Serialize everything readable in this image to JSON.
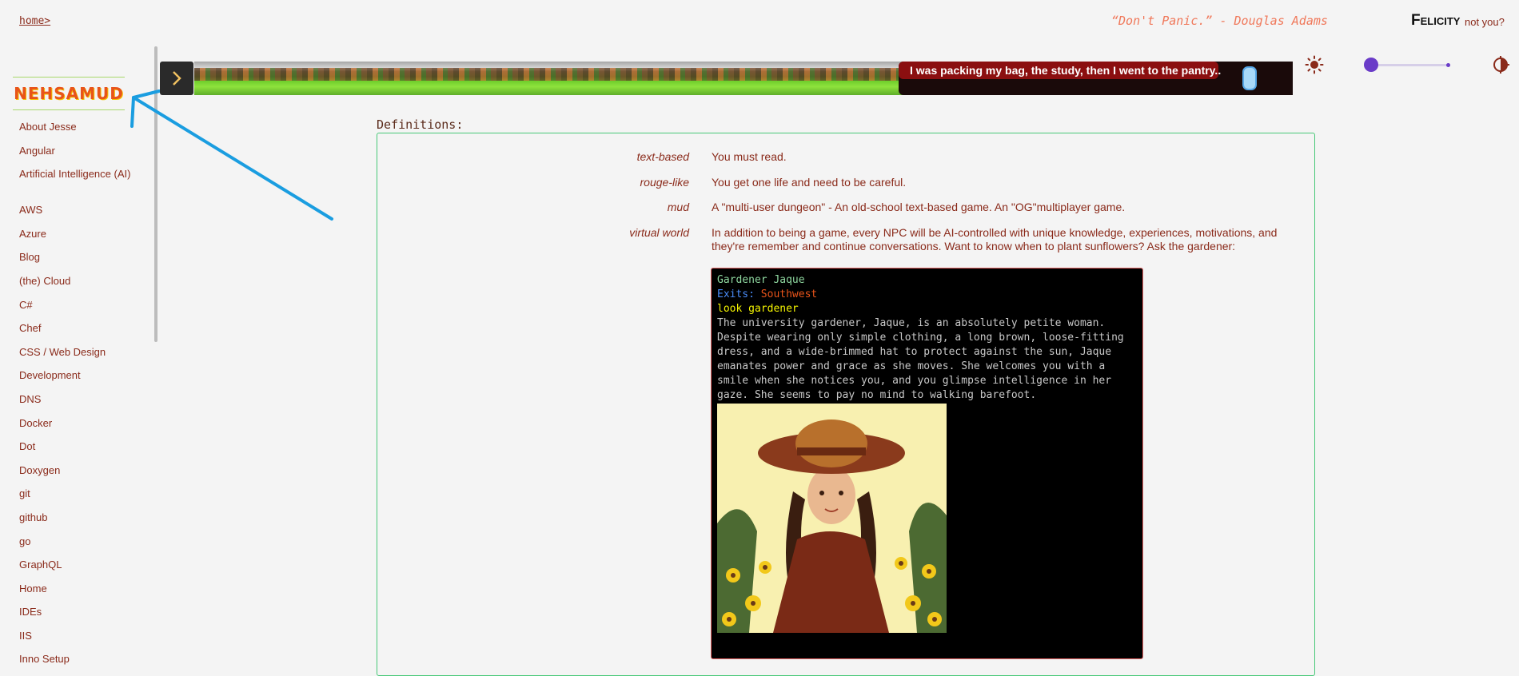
{
  "header": {
    "breadcrumb": "home>",
    "quote": "“Don't Panic.” - Douglas Adams",
    "user_name": "Felicity",
    "not_you": "not you?"
  },
  "sidebar": {
    "logo": "NEHSAMUD",
    "items": [
      "About Jesse",
      "Angular",
      "Artificial Intelligence (AI)",
      "AWS",
      "Azure",
      "Blog",
      "(the) Cloud",
      "C#",
      "Chef",
      "CSS / Web Design",
      "Development",
      "DNS",
      "Docker",
      "Dot",
      "Doxygen",
      "git",
      "github",
      "go",
      "GraphQL",
      "Home",
      "IDEs",
      "IIS",
      "Inno Setup"
    ]
  },
  "banner": {
    "message": "I was packing my bag, the study, then I went to the pantry.."
  },
  "theme_slider": {
    "value": 0
  },
  "icons": {
    "sun": "sun-icon",
    "moon": "half-moon-icon",
    "toggle": "chevron-right-icon",
    "mouse": "mouse-icon"
  },
  "colors": {
    "accent": "#8a2a1a",
    "quote": "#f0785a",
    "box_border": "#48c878",
    "terminal_border": "#e06060",
    "slider": "#6a3cc8",
    "annotation_arrow": "#1a9de0"
  },
  "definitions": {
    "title": "Definitions:",
    "items": [
      {
        "term": "text-based",
        "desc": "You must read."
      },
      {
        "term": "rouge-like",
        "desc": "You get one life and need to be careful."
      },
      {
        "term": "mud",
        "desc": "A \"multi-user dungeon\" - An old-school text-based game. An \"OG\"multiplayer game."
      },
      {
        "term": "virtual world",
        "desc": "In addition to being a game, every NPC will be AI-controlled with unique knowledge, experiences, motivations, and they're remember and continue conversations. Want to know when to plant sunflowers? Ask the gardener:"
      }
    ]
  },
  "terminal": {
    "npc_name": "Gardener Jaque",
    "exits_label": "Exits:",
    "exits_value": "Southwest",
    "command": "look gardener",
    "description": "The university gardener, Jaque, is an absolutely petite woman. Despite wearing only simple clothing, a long brown, loose-fitting dress, and a wide-brimmed hat to protect against the sun, Jaque emanates power and grace as she moves. She welcomes you with a smile when she notices you, and you glimpse intelligence in her gaze. She seems to pay no mind to walking barefoot."
  }
}
